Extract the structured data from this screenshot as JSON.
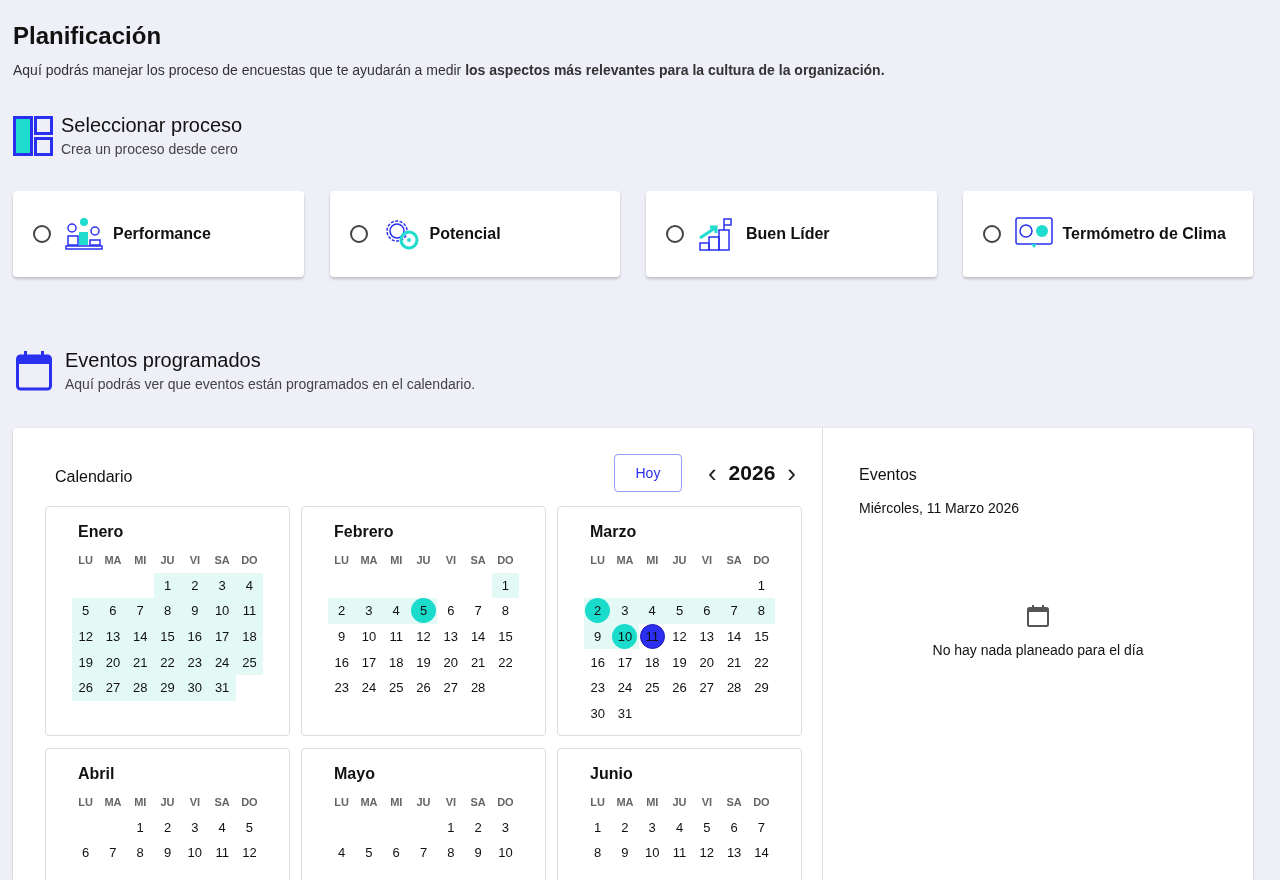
{
  "page": {
    "title": "Planificación",
    "description": "Aquí podrás manejar los proceso de encuestas que te ayudarán a medir **los aspectos más relevantes para la cultura de la organización.**"
  },
  "process_section": {
    "title": "Seleccionar proceso",
    "subtitle": "Crea un proceso desde cero"
  },
  "processes": [
    {
      "label": "Performance",
      "kind": "podium",
      "selected": false
    },
    {
      "label": "Potencial",
      "kind": "gears",
      "selected": false
    },
    {
      "label": "Buen Líder",
      "kind": "steps",
      "selected": false
    },
    {
      "label": "Termómetro de Clima",
      "kind": "faces",
      "selected": false
    }
  ],
  "events_section": {
    "title": "Eventos programados",
    "subtitle": "Aquí podrás ver que eventos están programados en el calendario."
  },
  "calendar": {
    "title": "Calendario",
    "today_button": "Hoy",
    "year": "2026",
    "prev": "‹",
    "next": "›",
    "months": [
      {
        "name": "Enero",
        "weekdays": [
          "LU",
          "MA",
          "MI",
          "JU",
          "VI",
          "SA",
          "DO"
        ],
        "weeks": [
          [
            {
              "n": "1",
              "range": true,
              "event": false,
              "selected": false
            },
            {
              "n": "2",
              "range": true,
              "event": false,
              "selected": false
            },
            {
              "n": "3",
              "range": true,
              "event": false,
              "selected": false
            },
            {
              "n": "4",
              "range": true,
              "event": false,
              "selected": false
            }
          ],
          [
            {
              "n": "5",
              "range": true,
              "event": false,
              "selected": false
            },
            {
              "n": "6",
              "range": true,
              "event": false,
              "selected": false
            },
            {
              "n": "7",
              "range": true,
              "event": false,
              "selected": false
            },
            {
              "n": "8",
              "range": true,
              "event": false,
              "selected": false
            },
            {
              "n": "9",
              "range": true,
              "event": false,
              "selected": false
            },
            {
              "n": "10",
              "range": true,
              "event": false,
              "selected": false
            },
            {
              "n": "11",
              "range": true,
              "event": false,
              "selected": false
            }
          ],
          [
            {
              "n": "12",
              "range": true,
              "event": false,
              "selected": false
            },
            {
              "n": "13",
              "range": true,
              "event": false,
              "selected": false
            },
            {
              "n": "14",
              "range": true,
              "event": false,
              "selected": false
            },
            {
              "n": "15",
              "range": true,
              "event": false,
              "selected": false
            },
            {
              "n": "16",
              "range": true,
              "event": false,
              "selected": false
            },
            {
              "n": "17",
              "range": true,
              "event": false,
              "selected": false
            },
            {
              "n": "18",
              "range": true,
              "event": false,
              "selected": false
            }
          ],
          [
            {
              "n": "19",
              "range": true,
              "event": false,
              "selected": false
            },
            {
              "n": "20",
              "range": true,
              "event": false,
              "selected": false
            },
            {
              "n": "21",
              "range": true,
              "event": false,
              "selected": false
            },
            {
              "n": "22",
              "range": true,
              "event": false,
              "selected": false
            },
            {
              "n": "23",
              "range": true,
              "event": false,
              "selected": false
            },
            {
              "n": "24",
              "range": true,
              "event": false,
              "selected": false
            },
            {
              "n": "25",
              "range": true,
              "event": false,
              "selected": false
            }
          ],
          [
            {
              "n": "26",
              "range": true,
              "event": false,
              "selected": false
            },
            {
              "n": "27",
              "range": true,
              "event": false,
              "selected": false
            },
            {
              "n": "28",
              "range": true,
              "event": false,
              "selected": false
            },
            {
              "n": "29",
              "range": true,
              "event": false,
              "selected": false
            },
            {
              "n": "30",
              "range": true,
              "event": false,
              "selected": false
            },
            {
              "n": "31",
              "range": true,
              "event": false,
              "selected": false
            }
          ]
        ]
      },
      {
        "name": "Febrero",
        "weekdays": [
          "LU",
          "MA",
          "MI",
          "JU",
          "VI",
          "SA",
          "DO"
        ],
        "weeks": [
          [
            {
              "n": "1",
              "range": true,
              "event": false,
              "selected": false
            }
          ],
          [
            {
              "n": "2",
              "range": true,
              "event": false,
              "selected": false
            },
            {
              "n": "3",
              "range": true,
              "event": false,
              "selected": false
            },
            {
              "n": "4",
              "range": true,
              "event": false,
              "selected": false
            },
            {
              "n": "5",
              "range": true,
              "event": true,
              "selected": false
            },
            {
              "n": "6",
              "range": false,
              "event": false,
              "selected": false
            },
            {
              "n": "7",
              "range": false,
              "event": false,
              "selected": false
            },
            {
              "n": "8",
              "range": false,
              "event": false,
              "selected": false
            }
          ],
          [
            {
              "n": "9",
              "range": false,
              "event": false,
              "selected": false
            },
            {
              "n": "10",
              "range": false,
              "event": false,
              "selected": false
            },
            {
              "n": "11",
              "range": false,
              "event": false,
              "selected": false
            },
            {
              "n": "12",
              "range": false,
              "event": false,
              "selected": false
            },
            {
              "n": "13",
              "range": false,
              "event": false,
              "selected": false
            },
            {
              "n": "14",
              "range": false,
              "event": false,
              "selected": false
            },
            {
              "n": "15",
              "range": false,
              "event": false,
              "selected": false
            }
          ],
          [
            {
              "n": "16",
              "range": false,
              "event": false,
              "selected": false
            },
            {
              "n": "17",
              "range": false,
              "event": false,
              "selected": false
            },
            {
              "n": "18",
              "range": false,
              "event": false,
              "selected": false
            },
            {
              "n": "19",
              "range": false,
              "event": false,
              "selected": false
            },
            {
              "n": "20",
              "range": false,
              "event": false,
              "selected": false
            },
            {
              "n": "21",
              "range": false,
              "event": false,
              "selected": false
            },
            {
              "n": "22",
              "range": false,
              "event": false,
              "selected": false
            }
          ],
          [
            {
              "n": "23",
              "range": false,
              "event": false,
              "selected": false
            },
            {
              "n": "24",
              "range": false,
              "event": false,
              "selected": false
            },
            {
              "n": "25",
              "range": false,
              "event": false,
              "selected": false
            },
            {
              "n": "26",
              "range": false,
              "event": false,
              "selected": false
            },
            {
              "n": "27",
              "range": false,
              "event": false,
              "selected": false
            },
            {
              "n": "28",
              "range": false,
              "event": false,
              "selected": false
            }
          ]
        ]
      },
      {
        "name": "Marzo",
        "weekdays": [
          "LU",
          "MA",
          "MI",
          "JU",
          "VI",
          "SA",
          "DO"
        ],
        "weeks": [
          [
            {
              "n": "1",
              "range": false,
              "event": false,
              "selected": false
            }
          ],
          [
            {
              "n": "2",
              "range": true,
              "event": true,
              "selected": false
            },
            {
              "n": "3",
              "range": true,
              "event": false,
              "selected": false
            },
            {
              "n": "4",
              "range": true,
              "event": false,
              "selected": false
            },
            {
              "n": "5",
              "range": true,
              "event": false,
              "selected": false
            },
            {
              "n": "6",
              "range": true,
              "event": false,
              "selected": false
            },
            {
              "n": "7",
              "range": true,
              "event": false,
              "selected": false
            },
            {
              "n": "8",
              "range": true,
              "event": false,
              "selected": false
            }
          ],
          [
            {
              "n": "9",
              "range": true,
              "event": false,
              "selected": false
            },
            {
              "n": "10",
              "range": true,
              "event": true,
              "selected": false
            },
            {
              "n": "11",
              "range": false,
              "event": false,
              "selected": true
            },
            {
              "n": "12",
              "range": false,
              "event": false,
              "selected": false
            },
            {
              "n": "13",
              "range": false,
              "event": false,
              "selected": false
            },
            {
              "n": "14",
              "range": false,
              "event": false,
              "selected": false
            },
            {
              "n": "15",
              "range": false,
              "event": false,
              "selected": false
            }
          ],
          [
            {
              "n": "16",
              "range": false,
              "event": false,
              "selected": false
            },
            {
              "n": "17",
              "range": false,
              "event": false,
              "selected": false
            },
            {
              "n": "18",
              "range": false,
              "event": false,
              "selected": false
            },
            {
              "n": "19",
              "range": false,
              "event": false,
              "selected": false
            },
            {
              "n": "20",
              "range": false,
              "event": false,
              "selected": false
            },
            {
              "n": "21",
              "range": false,
              "event": false,
              "selected": false
            },
            {
              "n": "22",
              "range": false,
              "event": false,
              "selected": false
            }
          ],
          [
            {
              "n": "23",
              "range": false,
              "event": false,
              "selected": false
            },
            {
              "n": "24",
              "range": false,
              "event": false,
              "selected": false
            },
            {
              "n": "25",
              "range": false,
              "event": false,
              "selected": false
            },
            {
              "n": "26",
              "range": false,
              "event": false,
              "selected": false
            },
            {
              "n": "27",
              "range": false,
              "event": false,
              "selected": false
            },
            {
              "n": "28",
              "range": false,
              "event": false,
              "selected": false
            },
            {
              "n": "29",
              "range": false,
              "event": false,
              "selected": false
            }
          ],
          [
            {
              "n": "30",
              "range": false,
              "event": false,
              "selected": false
            },
            {
              "n": "31",
              "range": false,
              "event": false,
              "selected": false
            }
          ]
        ]
      },
      {
        "name": "Abril",
        "weekdays": [
          "LU",
          "MA",
          "MI",
          "JU",
          "VI",
          "SA",
          "DO"
        ],
        "weeks": [
          [
            {
              "n": "1",
              "range": false,
              "event": false,
              "selected": false
            },
            {
              "n": "2",
              "range": false,
              "event": false,
              "selected": false
            },
            {
              "n": "3",
              "range": false,
              "event": false,
              "selected": false
            },
            {
              "n": "4",
              "range": false,
              "event": false,
              "selected": false
            },
            {
              "n": "5",
              "range": false,
              "event": false,
              "selected": false
            }
          ],
          [
            {
              "n": "6",
              "range": false,
              "event": false,
              "selected": false
            },
            {
              "n": "7",
              "range": false,
              "event": false,
              "selected": false
            },
            {
              "n": "8",
              "range": false,
              "event": false,
              "selected": false
            },
            {
              "n": "9",
              "range": false,
              "event": false,
              "selected": false
            },
            {
              "n": "10",
              "range": false,
              "event": false,
              "selected": false
            },
            {
              "n": "11",
              "range": false,
              "event": false,
              "selected": false
            },
            {
              "n": "12",
              "range": false,
              "event": false,
              "selected": false
            }
          ]
        ]
      },
      {
        "name": "Mayo",
        "weekdays": [
          "LU",
          "MA",
          "MI",
          "JU",
          "VI",
          "SA",
          "DO"
        ],
        "weeks": [
          [
            {
              "n": "1",
              "range": false,
              "event": false,
              "selected": false
            },
            {
              "n": "2",
              "range": false,
              "event": false,
              "selected": false
            },
            {
              "n": "3",
              "range": false,
              "event": false,
              "selected": false
            }
          ],
          [
            {
              "n": "4",
              "range": false,
              "event": false,
              "selected": false
            },
            {
              "n": "5",
              "range": false,
              "event": false,
              "selected": false
            },
            {
              "n": "6",
              "range": false,
              "event": false,
              "selected": false
            },
            {
              "n": "7",
              "range": false,
              "event": false,
              "selected": false
            },
            {
              "n": "8",
              "range": false,
              "event": false,
              "selected": false
            },
            {
              "n": "9",
              "range": false,
              "event": false,
              "selected": false
            },
            {
              "n": "10",
              "range": false,
              "event": false,
              "selected": false
            }
          ]
        ]
      },
      {
        "name": "Junio",
        "weekdays": [
          "LU",
          "MA",
          "MI",
          "JU",
          "VI",
          "SA",
          "DO"
        ],
        "weeks": [
          [
            {
              "n": "1",
              "range": false,
              "event": false,
              "selected": false
            },
            {
              "n": "2",
              "range": false,
              "event": false,
              "selected": false
            },
            {
              "n": "3",
              "range": false,
              "event": false,
              "selected": false
            },
            {
              "n": "4",
              "range": false,
              "event": false,
              "selected": false
            },
            {
              "n": "5",
              "range": false,
              "event": false,
              "selected": false
            },
            {
              "n": "6",
              "range": false,
              "event": false,
              "selected": false
            },
            {
              "n": "7",
              "range": false,
              "event": false,
              "selected": false
            }
          ],
          [
            {
              "n": "8",
              "range": false,
              "event": false,
              "selected": false
            },
            {
              "n": "9",
              "range": false,
              "event": false,
              "selected": false
            },
            {
              "n": "10",
              "range": false,
              "event": false,
              "selected": false
            },
            {
              "n": "11",
              "range": false,
              "event": false,
              "selected": false
            },
            {
              "n": "12",
              "range": false,
              "event": false,
              "selected": false
            },
            {
              "n": "13",
              "range": false,
              "event": false,
              "selected": false
            },
            {
              "n": "14",
              "range": false,
              "event": false,
              "selected": false
            }
          ]
        ]
      }
    ]
  },
  "events_panel": {
    "title": "Eventos",
    "date": "Miércoles, 11 Marzo 2026",
    "empty_message": "No hay nada planeado para el día"
  }
}
